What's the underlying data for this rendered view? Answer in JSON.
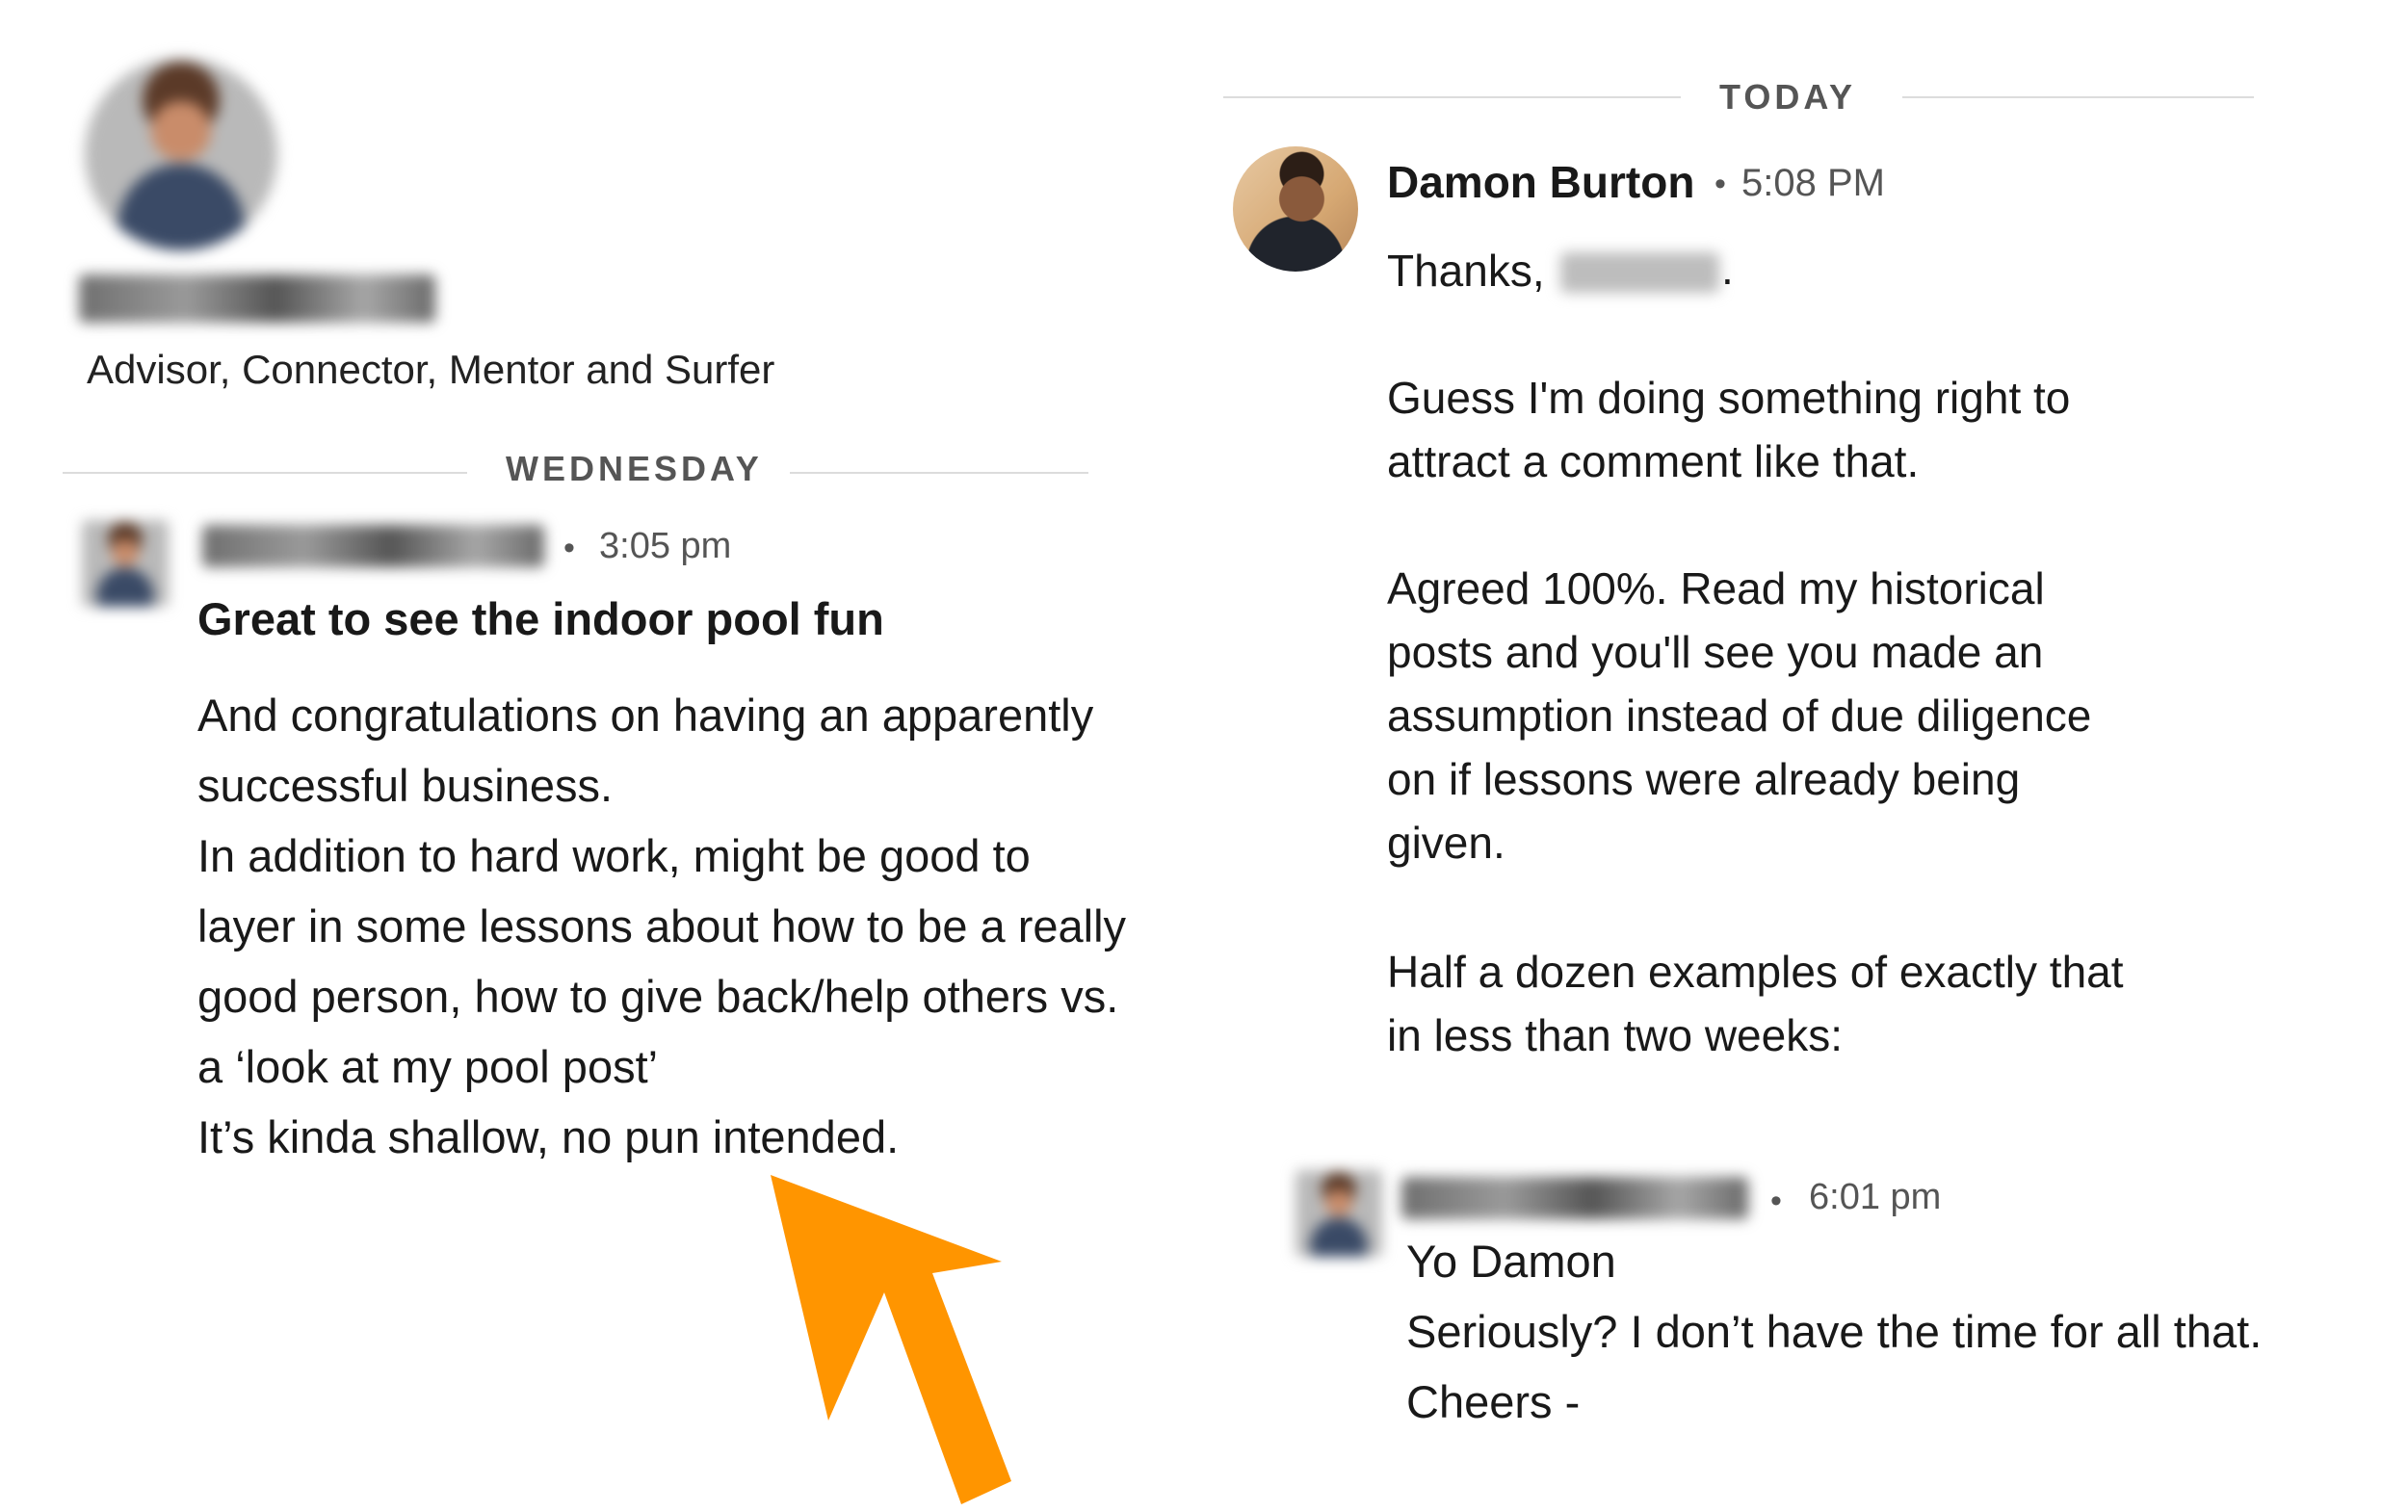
{
  "profile": {
    "headline": "Advisor, Connector, Mentor and Surfer"
  },
  "left_thread": {
    "day_label": "WEDNESDAY",
    "message": {
      "time": "3:05 pm",
      "subject": "Great to see the indoor pool fun",
      "body": "And congratulations on having an apparently\nsuccessful business.\nIn addition to hard work, might be good to\nlayer in some lessons about how to be a really\ngood person, how to give back/help others vs.\na ‘look at my pool post’\nIt’s kinda shallow, no pun intended."
    }
  },
  "right_thread": {
    "day_label": "TODAY",
    "reply": {
      "sender": "Damon Burton",
      "time": "5:08 PM",
      "greeting": "Thanks,",
      "paragraph1": "Guess I'm doing something right to\nattract a comment like that.",
      "paragraph2": "Agreed 100%. Read my historical\nposts and you'll see you made an\nassumption instead of due diligence\non if lessons were already being\ngiven.",
      "paragraph3": "Half a dozen examples of exactly that\nin less than two weeks:"
    },
    "followup": {
      "time": "6:01 pm",
      "body": "Yo Damon\nSeriously? I don’t have the time for all that.\nCheers -"
    }
  },
  "colors": {
    "arrow": "#ff9500",
    "divider": "#dcdcdc",
    "meta_text": "#555555"
  },
  "icons": {
    "dot_separator": "•",
    "arrow_annotation": "orange-arrow-icon"
  }
}
